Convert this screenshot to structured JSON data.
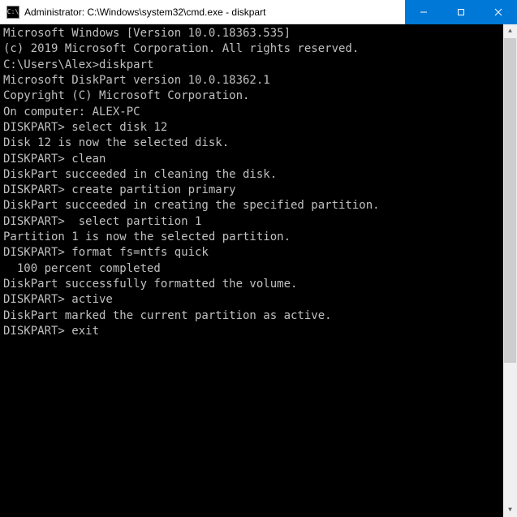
{
  "titlebar": {
    "icon_label": "C:\\",
    "title": "Administrator: C:\\Windows\\system32\\cmd.exe - diskpart"
  },
  "terminal": {
    "lines": [
      "Microsoft Windows [Version 10.0.18363.535]",
      "(c) 2019 Microsoft Corporation. All rights reserved.",
      "",
      "C:\\Users\\Alex>diskpart",
      "",
      "Microsoft DiskPart version 10.0.18362.1",
      "",
      "Copyright (C) Microsoft Corporation.",
      "On computer: ALEX-PC",
      "",
      "DISKPART> select disk 12",
      "",
      "Disk 12 is now the selected disk.",
      "",
      "DISKPART> clean",
      "",
      "DiskPart succeeded in cleaning the disk.",
      "",
      "DISKPART> create partition primary",
      "",
      "DiskPart succeeded in creating the specified partition.",
      "",
      "DISKPART>  select partition 1",
      "",
      "Partition 1 is now the selected partition.",
      "",
      "DISKPART> format fs=ntfs quick",
      "",
      "  100 percent completed",
      "",
      "DiskPart successfully formatted the volume.",
      "",
      "DISKPART> active",
      "",
      "DiskPart marked the current partition as active.",
      "",
      "DISKPART> exit"
    ]
  }
}
